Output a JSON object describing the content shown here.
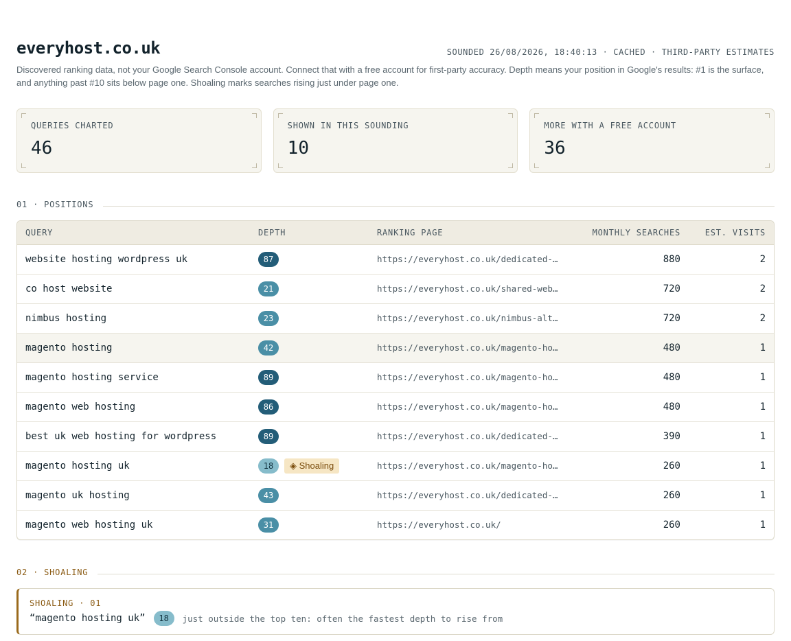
{
  "header": {
    "title": "everyhost.co.uk",
    "meta": "SOUNDED 26/08/2026, 18:40:13 · CACHED · THIRD-PARTY ESTIMATES",
    "intro": "Discovered ranking data, not your Google Search Console account. Connect that with a free account for first-party accuracy. Depth means your position in Google's results: #1 is the surface, and anything past #10 sits below page one. Shoaling marks searches rising just under page one."
  },
  "stats": [
    {
      "label": "QUERIES CHARTED",
      "value": "46"
    },
    {
      "label": "SHOWN IN THIS SOUNDING",
      "value": "10"
    },
    {
      "label": "MORE WITH A FREE ACCOUNT",
      "value": "36"
    }
  ],
  "positions": {
    "section_title": "01 · POSITIONS",
    "columns": {
      "query": "QUERY",
      "depth": "DEPTH",
      "page": "RANKING PAGE",
      "searches": "MONTHLY SEARCHES",
      "visits": "EST. VISITS"
    },
    "shoaling_label": "◈ Shoaling",
    "rows": [
      {
        "query": "website hosting wordpress uk",
        "depth": "87",
        "page": "https://everyhost.co.uk/dedicated-w…",
        "searches": "880",
        "visits": "2"
      },
      {
        "query": "co host website",
        "depth": "21",
        "page": "https://everyhost.co.uk/shared-web-…",
        "searches": "720",
        "visits": "2"
      },
      {
        "query": "nimbus hosting",
        "depth": "23",
        "page": "https://everyhost.co.uk/nimbus-alte…",
        "searches": "720",
        "visits": "2"
      },
      {
        "query": "magento hosting",
        "depth": "42",
        "page": "https://everyhost.co.uk/magento-hos…",
        "searches": "480",
        "visits": "1"
      },
      {
        "query": "magento hosting service",
        "depth": "89",
        "page": "https://everyhost.co.uk/magento-hos…",
        "searches": "480",
        "visits": "1"
      },
      {
        "query": "magento web hosting",
        "depth": "86",
        "page": "https://everyhost.co.uk/magento-hos…",
        "searches": "480",
        "visits": "1"
      },
      {
        "query": "best uk web hosting for wordpress",
        "depth": "89",
        "page": "https://everyhost.co.uk/dedicated-w…",
        "searches": "390",
        "visits": "1"
      },
      {
        "query": "magento hosting uk",
        "depth": "18",
        "page": "https://everyhost.co.uk/magento-hos…",
        "searches": "260",
        "visits": "1"
      },
      {
        "query": "magento uk hosting",
        "depth": "43",
        "page": "https://everyhost.co.uk/dedicated-m…",
        "searches": "260",
        "visits": "1"
      },
      {
        "query": "magento web hosting uk",
        "depth": "31",
        "page": "https://everyhost.co.uk/",
        "searches": "260",
        "visits": "1"
      }
    ]
  },
  "shoaling": {
    "section_title": "02 · SHOALING",
    "card_tag": "SHOALING · 01",
    "query": "“magento hosting uk”",
    "depth": "18",
    "note": "just outside the top ten: often the fastest depth to rise from"
  }
}
